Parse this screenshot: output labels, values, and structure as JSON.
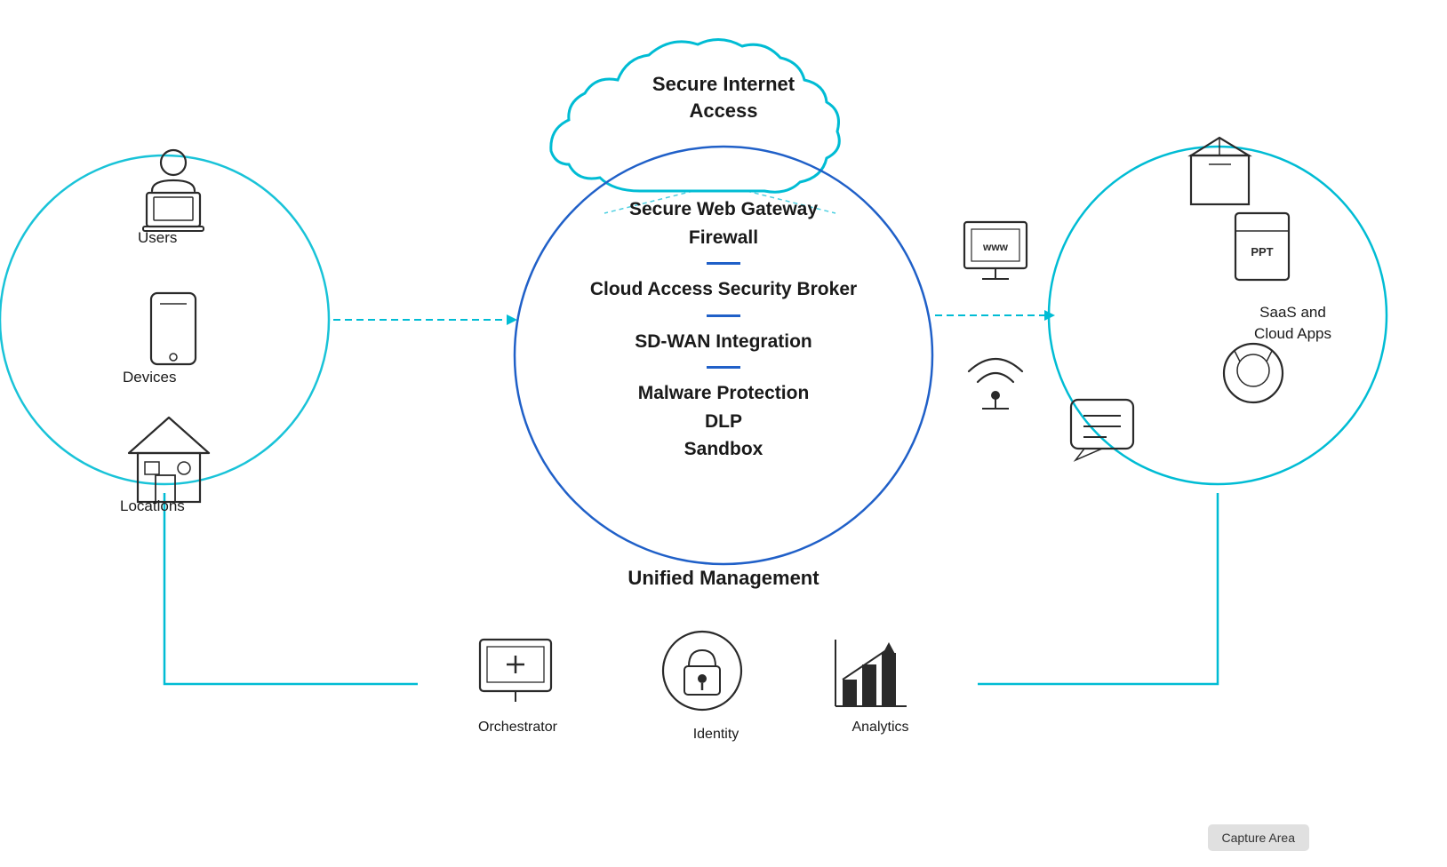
{
  "diagram": {
    "title": "Secure Internet Access",
    "cloud_label": "Secure Internet\nAccess",
    "center": {
      "rows": [
        {
          "text": "Secure Web Gateway",
          "bold": true
        },
        {
          "text": "Firewall",
          "bold": true
        },
        {
          "divider": true
        },
        {
          "text": "Cloud Access Security Broker",
          "bold": true
        },
        {
          "divider": true
        },
        {
          "text": "SD-WAN Integration",
          "bold": true
        },
        {
          "divider": true
        },
        {
          "text": "Malware Protection",
          "bold": true
        },
        {
          "text": "DLP",
          "bold": true
        },
        {
          "text": "Sandbox",
          "bold": true
        }
      ]
    },
    "left_items": [
      {
        "label": "Users",
        "icon": "user-laptop"
      },
      {
        "label": "Devices",
        "icon": "mobile"
      },
      {
        "label": "Locations",
        "icon": "home"
      }
    ],
    "right_items": [
      {
        "label": "SaaS and\nCloud Apps",
        "icons": [
          "box",
          "ppt",
          "wifi",
          "github",
          "chat"
        ]
      }
    ],
    "bottom": {
      "title": "Unified Management",
      "items": [
        {
          "label": "Orchestrator",
          "icon": "monitor-plus"
        },
        {
          "label": "Identity",
          "icon": "lock-circle"
        },
        {
          "label": "Analytics",
          "icon": "bar-chart"
        }
      ]
    },
    "capture_label": "Capture Area",
    "colors": {
      "teal": "#00bcd4",
      "blue": "#2060c8",
      "dark": "#1a1a1a",
      "light_gray": "#e8e8e8"
    }
  }
}
